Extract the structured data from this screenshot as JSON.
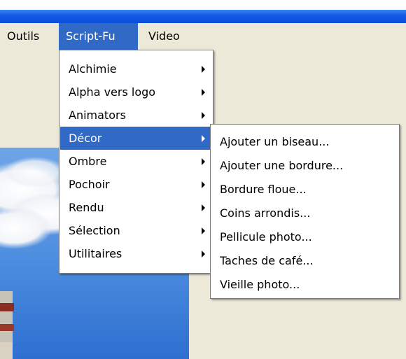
{
  "menubar": {
    "items": [
      {
        "label": "Outils"
      },
      {
        "label": "Script-Fu"
      },
      {
        "label": "Video"
      }
    ]
  },
  "script_fu_menu": {
    "items": [
      {
        "label": "Alchimie"
      },
      {
        "label": "Alpha vers logo"
      },
      {
        "label": "Animators"
      },
      {
        "label": "Décor"
      },
      {
        "label": "Ombre"
      },
      {
        "label": "Pochoir"
      },
      {
        "label": "Rendu"
      },
      {
        "label": "Sélection"
      },
      {
        "label": "Utilitaires"
      }
    ],
    "highlighted": "Décor"
  },
  "decor_submenu": {
    "items": [
      {
        "label": "Ajouter un biseau..."
      },
      {
        "label": "Ajouter une bordure..."
      },
      {
        "label": "Bordure floue..."
      },
      {
        "label": "Coins arrondis..."
      },
      {
        "label": "Pellicule photo..."
      },
      {
        "label": "Taches de café..."
      },
      {
        "label": "Vieille photo..."
      }
    ]
  },
  "colors": {
    "titlebar": "#0a4edb",
    "menu_highlight": "#3169c6",
    "window_background": "#ece9d8",
    "menu_background": "#ffffff"
  }
}
